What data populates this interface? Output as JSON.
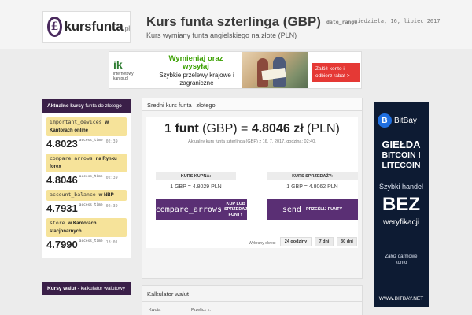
{
  "header": {
    "logo_mark": "£",
    "logo_text": "kursfunta",
    "logo_tld": ".pl",
    "title": "Kurs funta szterlinga (GBP)",
    "subtitle": "Kurs wymiany funta angielskiego na złote (PLN)",
    "date_key": "date_range",
    "date_value": "niedziela, 16, lipiec 2017"
  },
  "banner": {
    "ik_logo": "ik",
    "ik_sub": "internetowy kantor.pl",
    "line1": "Wymieniaj oraz wysyłaj",
    "line2": "Szybkie przelewy krajowe i zagraniczne",
    "cta": "Załóż konto i odbierz rabat >"
  },
  "sidebar": {
    "heading_bold": "Aktualne kursy",
    "heading_rest": "funta do złotego",
    "rates": [
      {
        "icon": "important_devices",
        "label": "w Kantorach online",
        "value": "4.8023",
        "sup": "access_time",
        "time": "02:39"
      },
      {
        "icon": "compare_arrows",
        "label": "na Rynku forex",
        "value": "4.8046",
        "sup": "access_time",
        "time": "02:39"
      },
      {
        "icon": "account_balance",
        "label": "w NBP",
        "value": "4.7931",
        "sup": "access_time",
        "time": "02:39"
      },
      {
        "icon": "store",
        "label": "w Kantorach stacjonarnych",
        "value": "4.7990",
        "sup": "access_time",
        "time": "18:01"
      }
    ],
    "currencies_heading_bold": "Kursy walut",
    "currencies_heading_rest": "- kalkulator walutowy"
  },
  "main": {
    "panel_title": "Średni kurs funta i złotego",
    "rate_prefix": "1 funt",
    "rate_gbp": "(GBP) =",
    "rate_value": "4.8046 zł",
    "rate_pln": "(PLN)",
    "caption": "Aktualny kurs funta szterlinga (GBP) z 16. 7. 2017, godzina: 02:40.",
    "buy_head": "KURS KUPNA:",
    "buy_value": "1  GBP  =  4.8029 PLN",
    "sell_head": "KURS SPRZEDAŻY:",
    "sell_value": "1  GBP  =  4.8062 PLN",
    "btn1_icon": "compare_arrows",
    "btn1_text": "KUP LUB SPRZEDAJ FUNTY",
    "btn2_icon": "send",
    "btn2_text": "PRZEŚLIJ FUNTY",
    "period_label": "Wybrany okres:",
    "periods": [
      "24 godziny",
      "7 dni",
      "30 dni"
    ]
  },
  "calculator": {
    "title": "Kalkulator walut",
    "amount_label": "Kwota",
    "convert_label": "Przelicz z:"
  },
  "ad": {
    "brand": "BitBay",
    "line1": "GIEŁDA",
    "line2": "BITCOIN I",
    "line3": "LITECOIN",
    "line4": "Szybki handel",
    "line5": "BEZ",
    "line6": "weryfikacji",
    "line7": "Załóż darmowe konto",
    "url": "WWW.BITBAY.NET"
  }
}
